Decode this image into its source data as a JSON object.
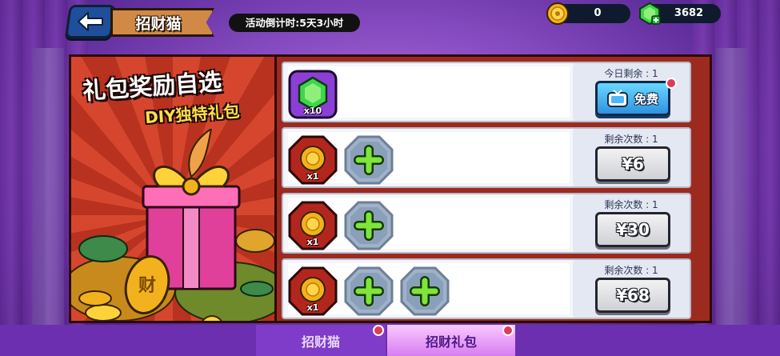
{
  "header": {
    "title": "招财猫",
    "countdown": "活动倒计时:5天3小时",
    "coins": "0",
    "gems": "3682"
  },
  "promo": {
    "title": "礼包奖励自选",
    "subtitle": "DIY独特礼包",
    "coin_glyph": "财"
  },
  "packs": [
    {
      "remain": "今日剩余 : 1",
      "item_count": "x10",
      "button": "免费",
      "type": "free"
    },
    {
      "remain": "剩余次数 : 1",
      "item_count": "x1",
      "button": "¥6",
      "type": "paid"
    },
    {
      "remain": "剩余次数 : 1",
      "item_count": "x1",
      "button": "¥30",
      "type": "paid"
    },
    {
      "remain": "剩余次数 : 1",
      "item_count": "x1",
      "button": "¥68",
      "type": "paid"
    }
  ],
  "tabs": [
    {
      "label": "招财猫"
    },
    {
      "label": "招财礼包"
    }
  ],
  "colors": {
    "accent_gold": "#ffc93c",
    "gem_green": "#3ed64a",
    "frame_red": "#9d2a1f",
    "free_blue": "#2f93e0"
  },
  "icons": [
    "back-arrow-icon",
    "coin-icon",
    "gem-icon",
    "tv-icon",
    "plus-icon",
    "notification-dot-icon"
  ]
}
